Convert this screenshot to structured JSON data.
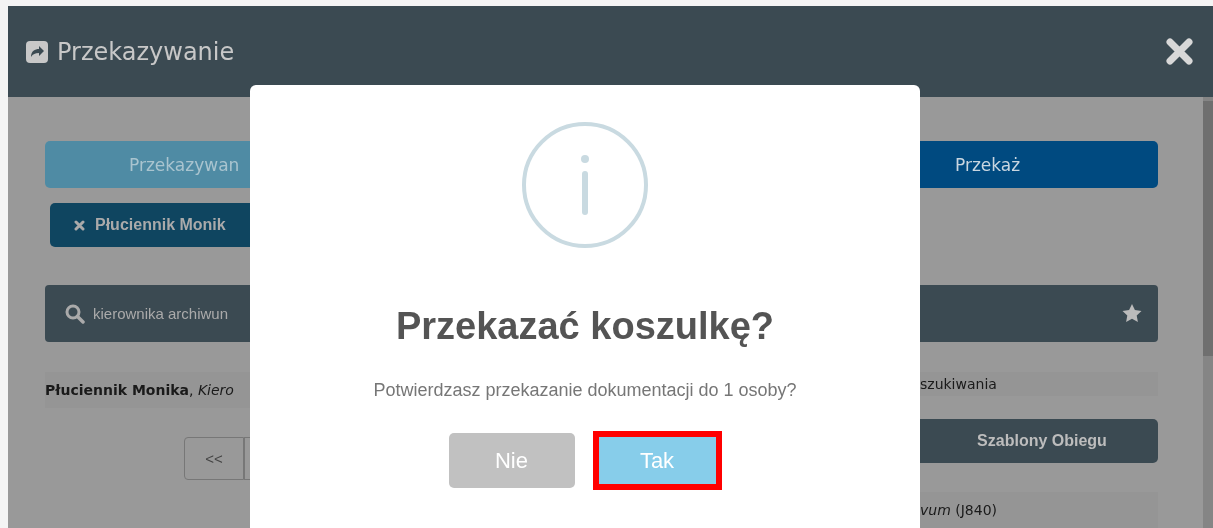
{
  "window": {
    "title": "Przekazywanie"
  },
  "tabs": [
    {
      "label": "Przekazywan",
      "selected": false
    },
    {
      "label": "Przekaż",
      "selected": true
    }
  ],
  "chips": [
    {
      "label": "Płuciennik Monik"
    }
  ],
  "search": {
    "value": "kierownika archiwun"
  },
  "results_left": [
    {
      "text": "**Płuciennik Monika**, *Kiero*"
    }
  ],
  "results_right": [
    {
      "text": "szukiwania"
    },
    {
      "text": "*vum* (J840)"
    }
  ],
  "pagination": [
    {
      "label": "<<"
    }
  ],
  "templates_button": {
    "label": "Szablony Obiegu"
  },
  "dialog": {
    "title": "Przekazać koszulkę?",
    "message": "Potwierdzasz przekazanie dokumentacji do 1 osoby?",
    "buttons": [
      {
        "label": "Nie",
        "kind": "cancel",
        "highlighted": false
      },
      {
        "label": "Tak",
        "kind": "confirm",
        "highlighted": true
      }
    ]
  }
}
